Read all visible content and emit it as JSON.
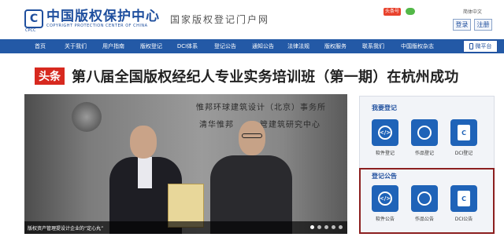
{
  "header": {
    "logo_mark": "C",
    "logo_cn": "中国版权保护中心",
    "logo_en": "COPYRIGHT PROTECTION CENTER OF CHINA",
    "logo_sub": "CPCC",
    "slogan": "国家版权登记门户网",
    "weibo_badge": "头条号",
    "lang": "简体中文",
    "login": "登录",
    "register": "注册"
  },
  "nav": {
    "items": [
      "首页",
      "关于我们",
      "用户指南",
      "版权登记",
      "DCI体系",
      "登记公告",
      "通知公告",
      "法律法规",
      "版权服务",
      "联系我们",
      "中国版权杂志"
    ],
    "weipingtai": "微平台"
  },
  "headline": {
    "tag": "头条",
    "text": "第八届全国版权经纪人专业实务培训班（第一期）在杭州成功"
  },
  "photo": {
    "sign1": "惟邦环球建筑设计（北京）事务所",
    "sign2": "清华惟邦　　　管建筑研究中心",
    "caption": "版权资产管理提设计企业的“定心丸”"
  },
  "panel": {
    "register_title": "我要登记",
    "register_tiles": [
      {
        "label": "软件登记",
        "icon": "code-icon",
        "glyph": "</>"
      },
      {
        "label": "作品登记",
        "icon": "artwork-icon",
        "glyph": ""
      },
      {
        "label": "DCI登记",
        "icon": "dci-icon",
        "glyph": "C"
      }
    ],
    "notice_title": "登记公告",
    "notice_tiles": [
      {
        "label": "软件公告",
        "icon": "code-icon",
        "glyph": "</>"
      },
      {
        "label": "作品公告",
        "icon": "artwork-icon",
        "glyph": ""
      },
      {
        "label": "DCI公告",
        "icon": "dci-icon",
        "glyph": "C"
      }
    ]
  },
  "colors": {
    "brand_blue": "#2359a6",
    "headline_red": "#d7291f",
    "highlight_border": "#8c1f1f"
  }
}
